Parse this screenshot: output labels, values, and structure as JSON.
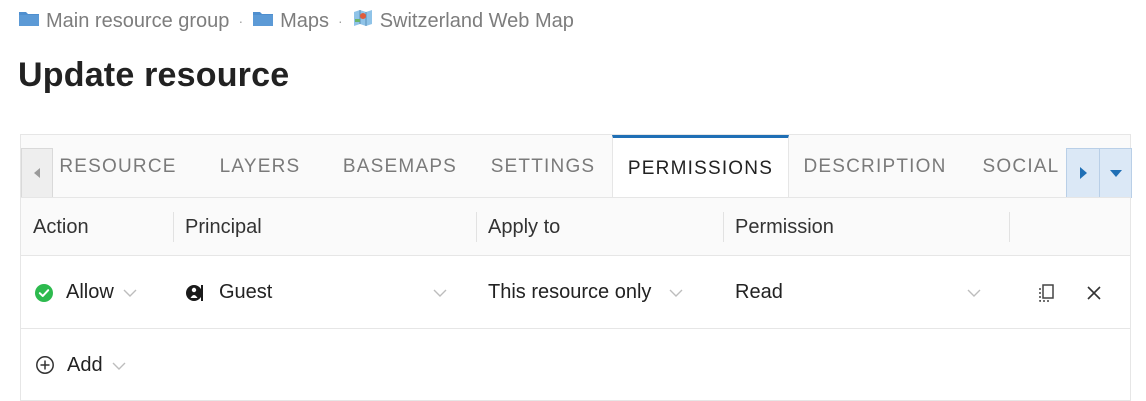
{
  "breadcrumb": {
    "items": [
      {
        "label": "Main resource group",
        "icon": "folder-icon"
      },
      {
        "label": "Maps",
        "icon": "folder-icon"
      },
      {
        "label": "Switzerland Web Map",
        "icon": "web-map-icon"
      }
    ],
    "separator": "·"
  },
  "page": {
    "title": "Update resource"
  },
  "tabs": {
    "items": [
      "RESOURCE",
      "LAYERS",
      "BASEMAPS",
      "SETTINGS",
      "PERMISSIONS",
      "DESCRIPTION",
      "SOCIAL"
    ],
    "active": "PERMISSIONS",
    "accent": "#1f6fb5"
  },
  "permissions": {
    "columns": [
      "Action",
      "Principal",
      "Apply to",
      "Permission"
    ],
    "rows": [
      {
        "action": "Allow",
        "action_status_color": "#2dba4e",
        "principal": "Guest",
        "principal_icon": "user-icon",
        "apply_to": "This resource only",
        "permission": "Read"
      }
    ],
    "add_label": "Add"
  }
}
